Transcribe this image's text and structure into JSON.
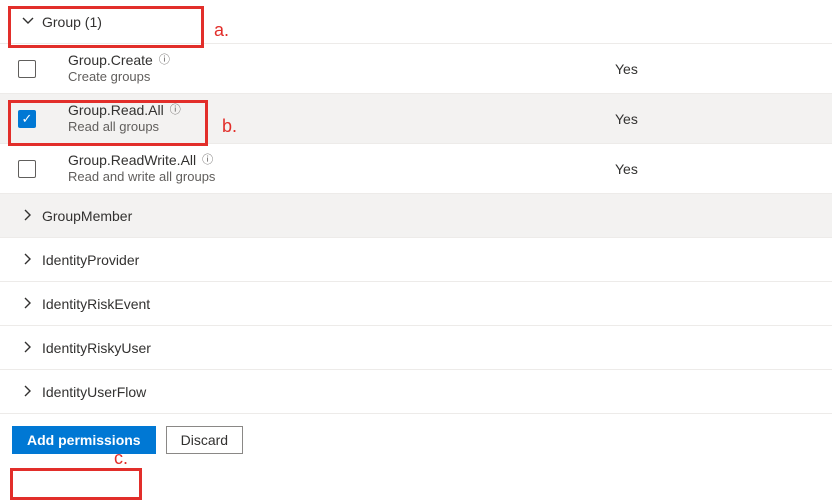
{
  "group_section": {
    "header": "Group (1)",
    "permissions": [
      {
        "name": "Group.Create",
        "desc": "Create groups",
        "admin": "Yes",
        "checked": false
      },
      {
        "name": "Group.Read.All",
        "desc": "Read all groups",
        "admin": "Yes",
        "checked": true
      },
      {
        "name": "Group.ReadWrite.All",
        "desc": "Read and write all groups",
        "admin": "Yes",
        "checked": false
      }
    ]
  },
  "collapsed_sections": [
    "GroupMember",
    "IdentityProvider",
    "IdentityRiskEvent",
    "IdentityRiskyUser",
    "IdentityUserFlow"
  ],
  "buttons": {
    "add": "Add permissions",
    "discard": "Discard"
  },
  "annotations": {
    "a": "a.",
    "b": "b.",
    "c": "c."
  }
}
